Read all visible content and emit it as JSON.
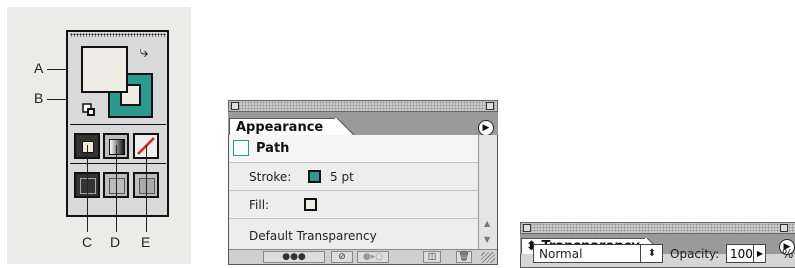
{
  "callouts": {
    "a": "A",
    "b": "B",
    "c": "C",
    "d": "D",
    "e": "E"
  },
  "appearance_panel": {
    "tab_label": "Appearance",
    "menu_icon": "triangle-right-icon",
    "object_label": "Path",
    "stroke_label": "Stroke:",
    "stroke_weight": "5 pt",
    "stroke_color": "#2a9a8e",
    "fill_label": "Fill:",
    "fill_color": "#efebe5",
    "default_transparency": "Default Transparency"
  },
  "transparency_panel": {
    "tab_label": "Transparency",
    "blend_mode": "Normal",
    "opacity_label": "Opacity:",
    "opacity_value": "100",
    "percent": "%"
  }
}
